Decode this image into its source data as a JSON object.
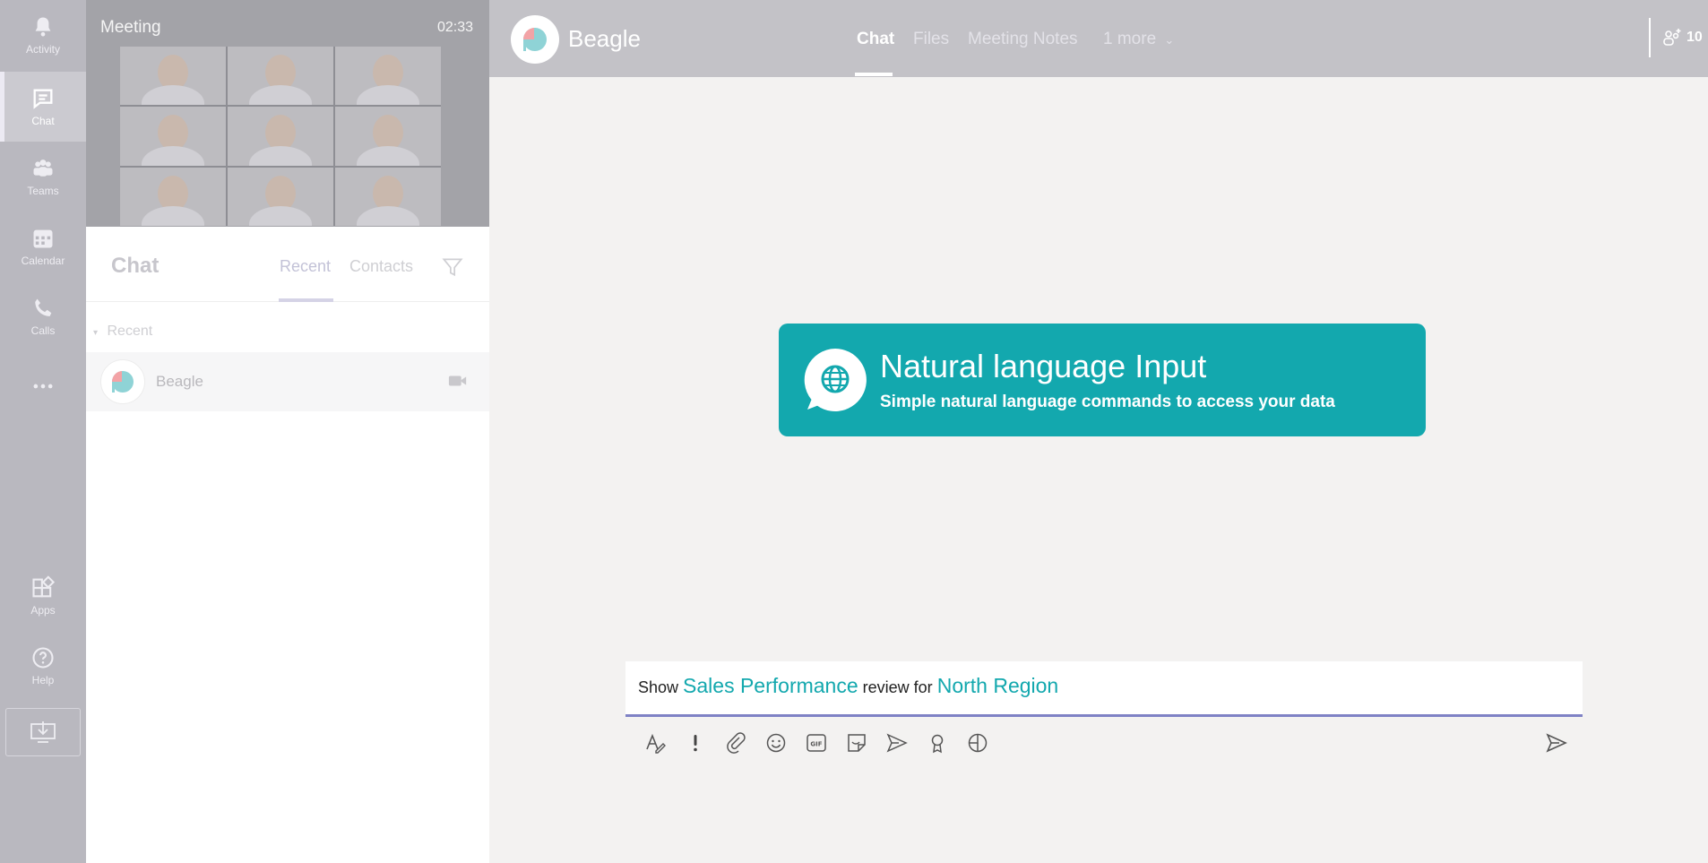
{
  "rail": {
    "items": [
      {
        "label": "Activity",
        "icon": "bell-icon"
      },
      {
        "label": "Chat",
        "icon": "chat-icon",
        "active": true
      },
      {
        "label": "Teams",
        "icon": "teams-icon"
      },
      {
        "label": "Calendar",
        "icon": "calendar-icon"
      },
      {
        "label": "Calls",
        "icon": "phone-icon"
      },
      {
        "label": "",
        "icon": "more-icon"
      },
      {
        "label": "Apps",
        "icon": "apps-icon"
      },
      {
        "label": "Help",
        "icon": "help-icon"
      }
    ],
    "download_icon": "download-icon"
  },
  "meeting": {
    "title": "Meeting",
    "time": "02:33"
  },
  "chat_pane": {
    "title": "Chat",
    "tabs": [
      "Recent",
      "Contacts"
    ],
    "section_label": "Recent",
    "items": [
      {
        "name": "Beagle"
      }
    ]
  },
  "topbar": {
    "app_name": "Beagle",
    "tabs": [
      "Chat",
      "Files",
      "Meeting Notes",
      "1 more"
    ],
    "active_tab": "Chat",
    "participants_count": "10"
  },
  "feature_card": {
    "title": "Natural language Input",
    "subtitle": "Simple natural language commands to access your data"
  },
  "composer": {
    "parts": [
      "Show",
      "Sales Performance",
      "review for",
      "North Region"
    ]
  },
  "colors": {
    "accent_teal": "#13a8ae",
    "composer_underline": "#7f82c5",
    "avatar_pink": "#f3a3a6",
    "avatar_teal": "#8fd3d6"
  }
}
